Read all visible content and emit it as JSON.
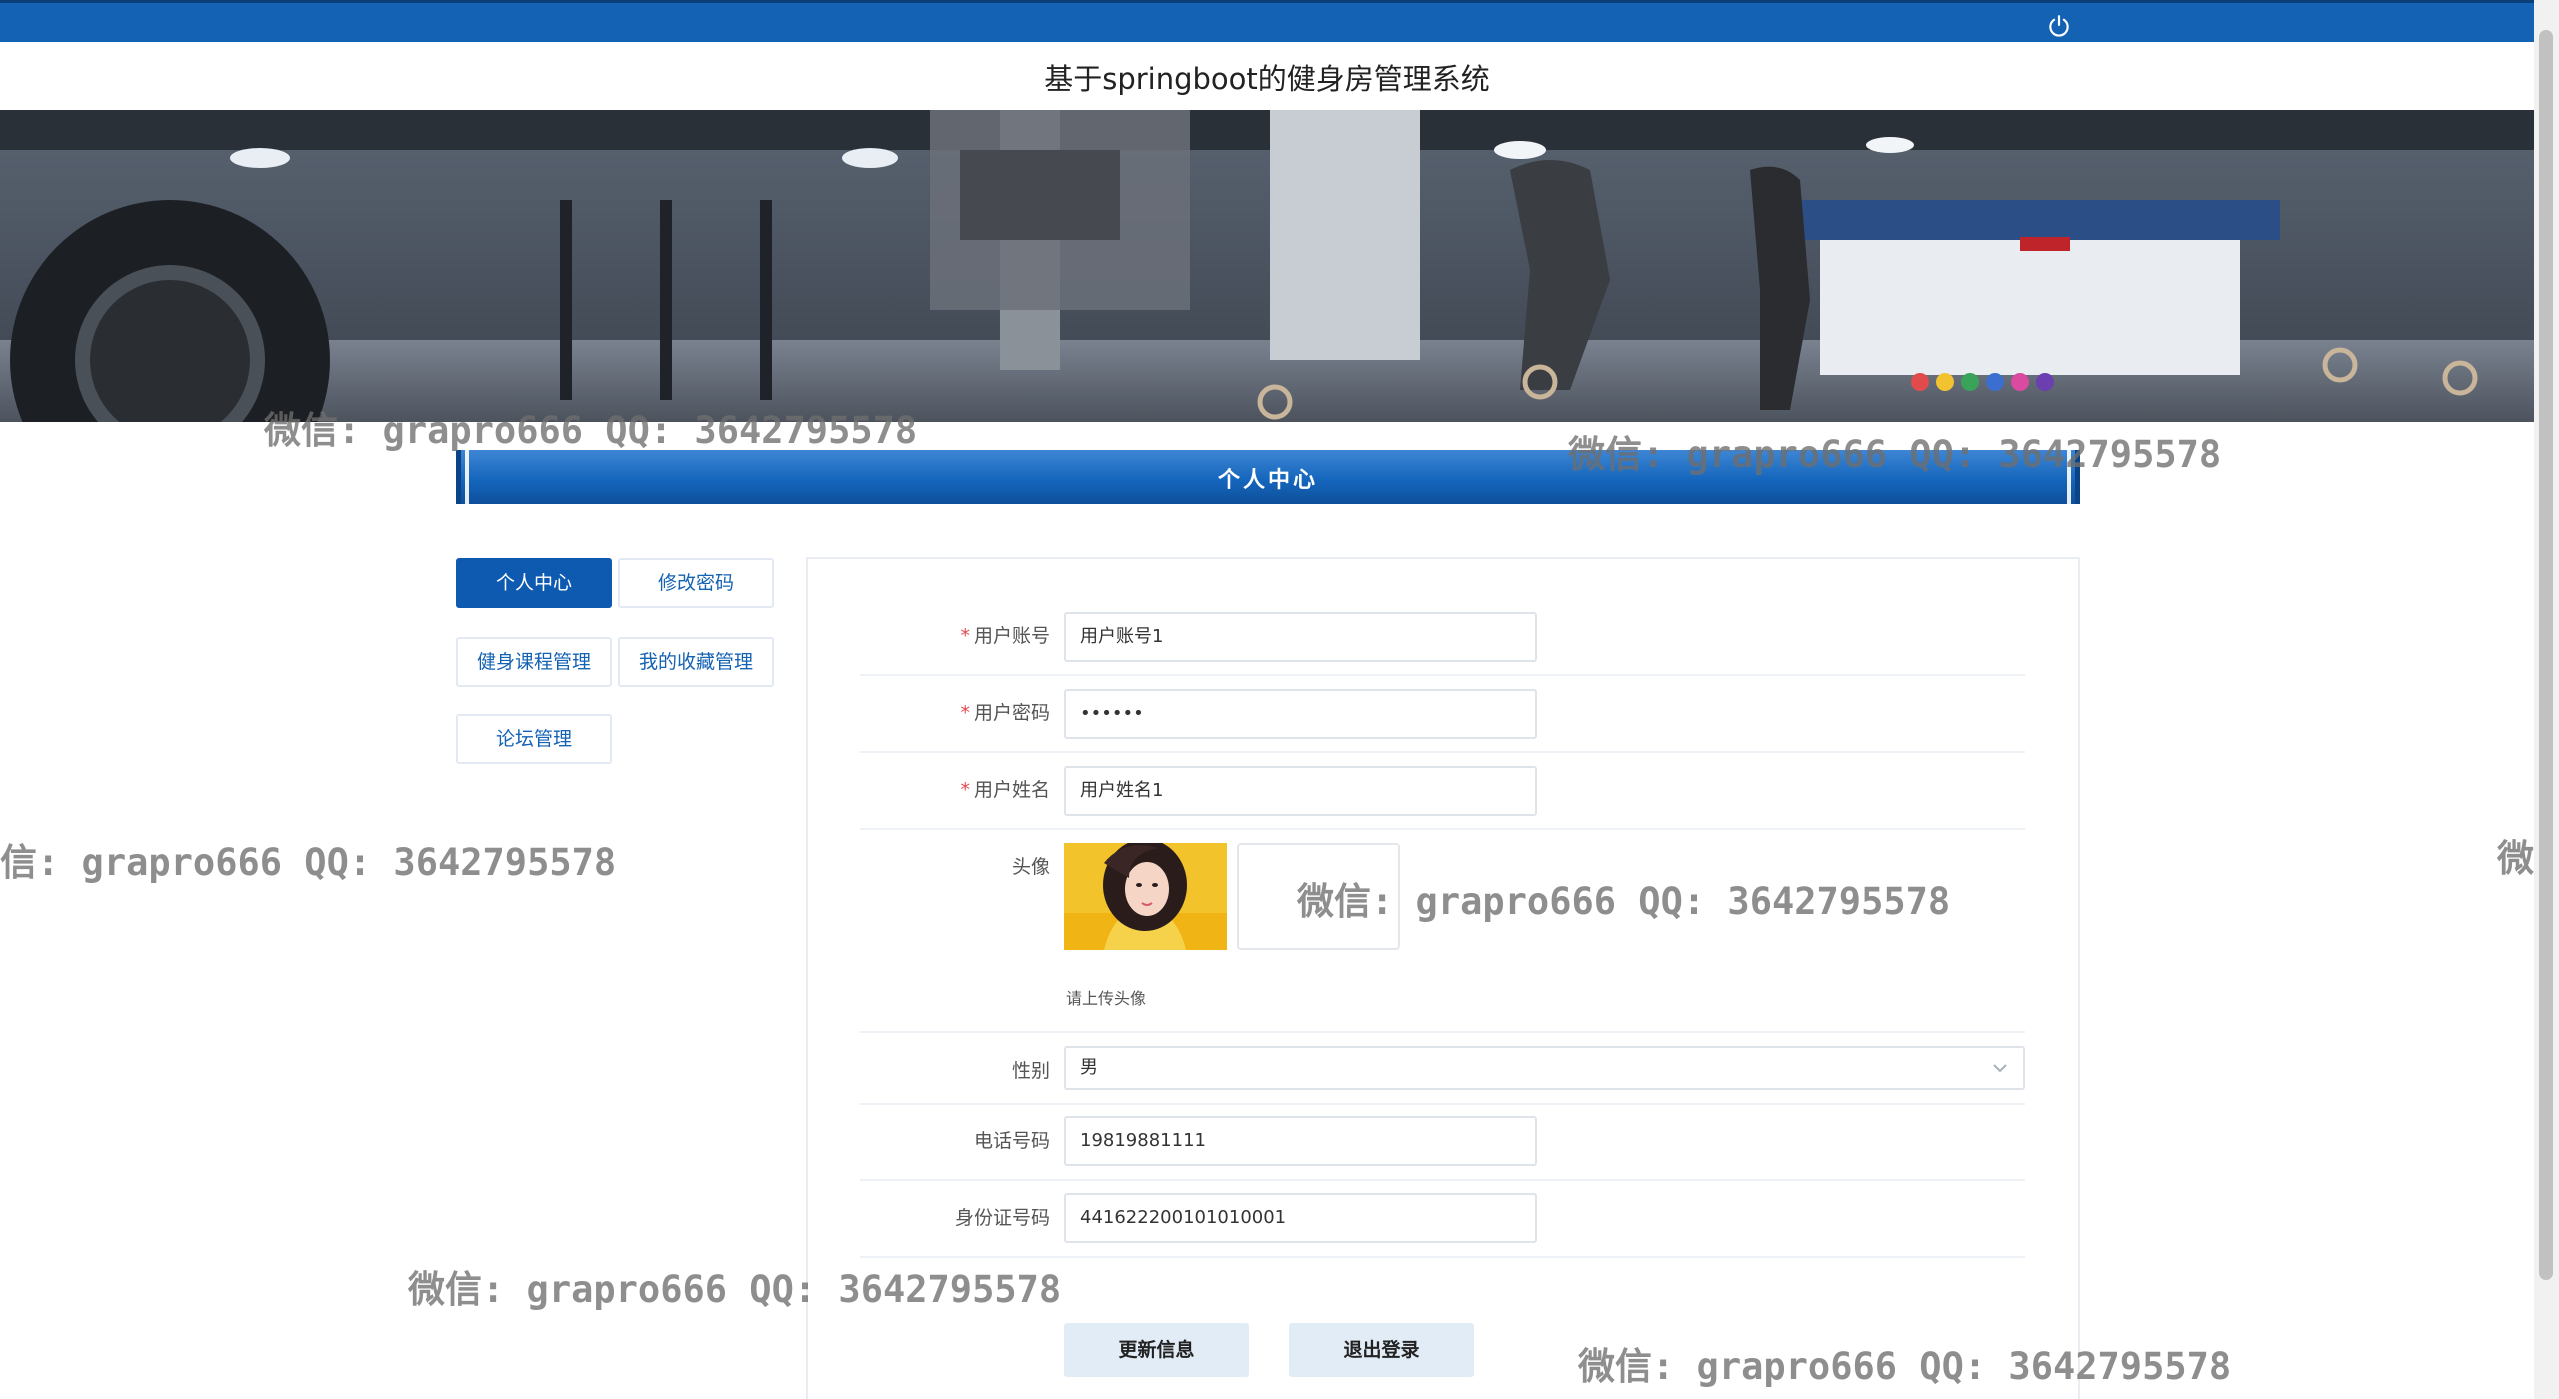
{
  "header": {
    "site_title": "基于springboot的健身房管理系统",
    "power_icon": "power-icon"
  },
  "section": {
    "title": "个人中心"
  },
  "sidebar": {
    "items": [
      {
        "label": "个人中心",
        "active": true
      },
      {
        "label": "修改密码",
        "active": false
      },
      {
        "label": "健身课程管理",
        "active": false
      },
      {
        "label": "我的收藏管理",
        "active": false
      },
      {
        "label": "论坛管理",
        "active": false
      }
    ]
  },
  "form": {
    "account": {
      "label": "用户账号",
      "required": true,
      "value": "用户账号1"
    },
    "password": {
      "label": "用户密码",
      "required": true,
      "value": "••••••"
    },
    "name": {
      "label": "用户姓名",
      "required": true,
      "value": "用户姓名1"
    },
    "avatar": {
      "label": "头像",
      "hint": "请上传头像"
    },
    "gender": {
      "label": "性别",
      "value": "男"
    },
    "phone": {
      "label": "电话号码",
      "value": "19819881111"
    },
    "id_card": {
      "label": "身份证号码",
      "value": "441622200101010001"
    }
  },
  "actions": {
    "update_label": "更新信息",
    "logout_label": "退出登录"
  },
  "watermarks": [
    "微信: grapro666 QQ: 3642795578",
    "微信: grapro666 QQ: 3642795578",
    "信: grapro666 QQ: 3642795578",
    "微信: grapro666 QQ: 3642795578",
    "微信: grapro666 QQ: 3642795578",
    "微信: grapro666 QQ: 3642795578",
    "微信"
  ],
  "colors": {
    "primary": "#1462b4",
    "required": "#e5484d",
    "button_bg": "#e1ecf7"
  }
}
